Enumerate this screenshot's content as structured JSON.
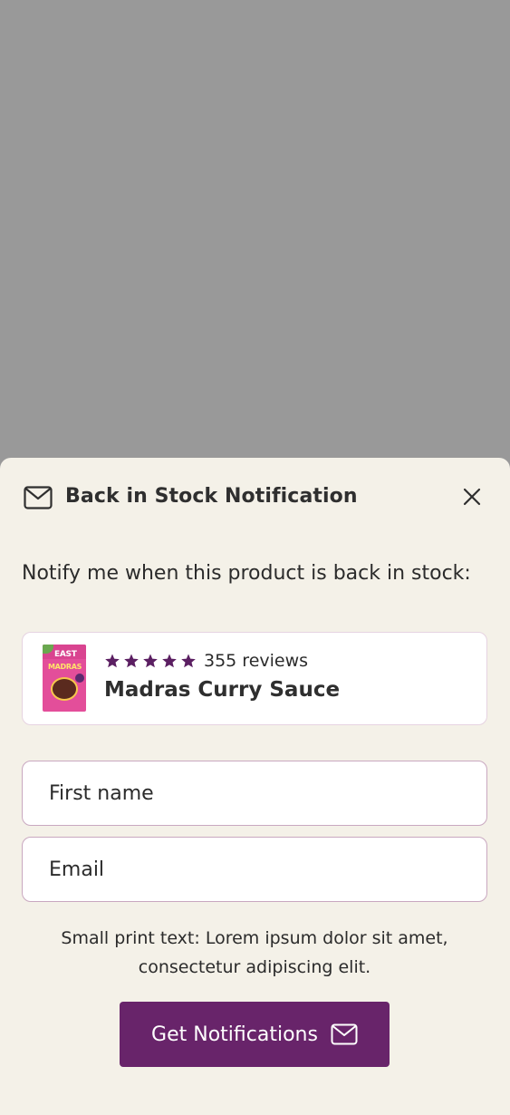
{
  "modal": {
    "title": "Back in Stock Notification",
    "title_icon": "mail-icon",
    "close_icon": "close-icon",
    "intro_text": "Notify me when this product is back in stock:"
  },
  "product": {
    "name": "Madras Curry Sauce",
    "rating_stars": 5,
    "reviews_label": "355 reviews",
    "thumbnail_icon": "product-thumbnail",
    "thumb_brand_text": "EAST",
    "thumb_name_text": "MADRAS"
  },
  "form": {
    "first_name_placeholder": "First name",
    "email_placeholder": "Email",
    "small_print": "Small print text: Lorem ipsum dolor sit amet, consectetur adipiscing elit.",
    "submit_label": "Get Notifications",
    "submit_icon": "mail-icon"
  },
  "colors": {
    "overlay": "#999999",
    "sheet_background": "#f4f1e8",
    "accent": "#68246a",
    "star": "#5b1f62",
    "input_border": "#c9a8c0"
  }
}
